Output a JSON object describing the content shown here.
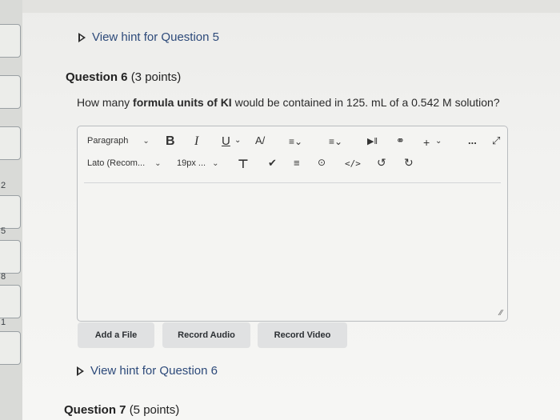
{
  "hints": {
    "q5": "View hint for Question 5",
    "q6": "View hint for Question 6"
  },
  "question6": {
    "label": "Question 6",
    "points": "(3 points)",
    "text_pre": "How many ",
    "text_bold1": "formula units of KI",
    "text_post": " would be contained in 125. mL of a 0.542 M solution?"
  },
  "question7": {
    "label": "Question 7",
    "points": "(5 points)"
  },
  "editor": {
    "paragraph_select": "Paragraph",
    "font_select": "Lato (Recom...",
    "size_select": "19px ...",
    "icons": {
      "bold": "B",
      "italic": "I",
      "underline": "U",
      "more": "...",
      "code": "</>",
      "add": "+"
    }
  },
  "buttons": {
    "add_file": "Add a File",
    "record_audio": "Record Audio",
    "record_video": "Record Video"
  },
  "edge_numbers": [
    "2",
    "5",
    "8",
    "1"
  ]
}
